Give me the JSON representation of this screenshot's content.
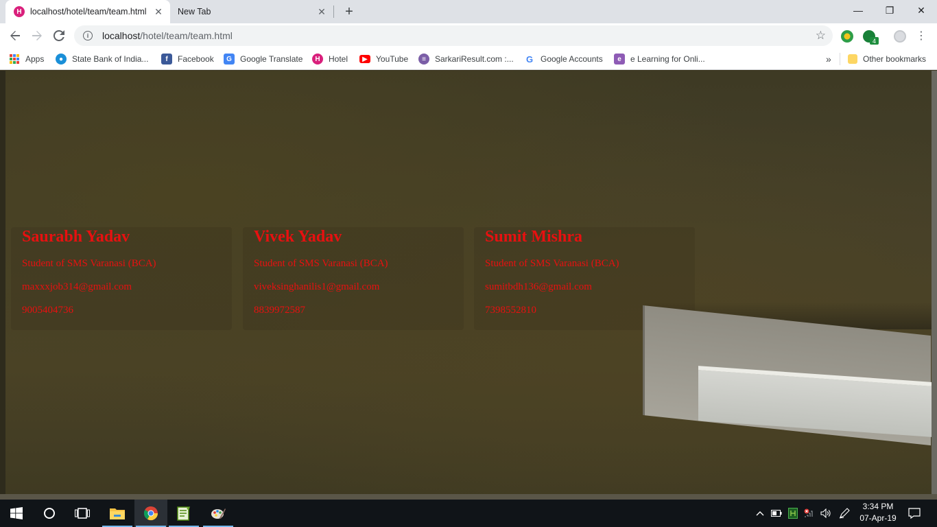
{
  "browser": {
    "tabs": [
      {
        "title": "localhost/hotel/team/team.html",
        "close": "✕"
      },
      {
        "title": "New Tab",
        "close": "✕"
      }
    ],
    "new_tab": "+",
    "window_controls": {
      "minimize": "—",
      "restore": "❐",
      "close": "✕"
    },
    "address": {
      "host": "localhost",
      "path": "/hotel/team/team.html"
    },
    "extension_badge": "4",
    "bookmarks": [
      {
        "label": "Apps",
        "icon": "apps-grid-icon"
      },
      {
        "label": "State Bank of India...",
        "icon": "sbi-icon"
      },
      {
        "label": "Facebook",
        "icon": "facebook-icon"
      },
      {
        "label": "Google Translate",
        "icon": "google-translate-icon"
      },
      {
        "label": "Hotel",
        "icon": "hotel-icon"
      },
      {
        "label": "YouTube",
        "icon": "youtube-icon"
      },
      {
        "label": "SarkariResult.com :...",
        "icon": "sarkari-icon"
      },
      {
        "label": "Google Accounts",
        "icon": "google-icon"
      },
      {
        "label": "e Learning for Onli...",
        "icon": "elearning-icon"
      }
    ],
    "overflow": "»",
    "other_bookmarks": "Other bookmarks"
  },
  "team": [
    {
      "name": "Saurabh Yadav",
      "role": "Student of SMS Varanasi (BCA)",
      "email": "maxxxjob314@gmail.com",
      "phone": "9005404736"
    },
    {
      "name": "Vivek Yadav",
      "role": "Student of SMS Varanasi (BCA)",
      "email": "viveksinghanilis1@gmail.com",
      "phone": "8839972587"
    },
    {
      "name": "Sumit Mishra",
      "role": "Student of SMS Varanasi (BCA)",
      "email": "sumitbdh136@gmail.com",
      "phone": "7398552810"
    }
  ],
  "taskbar": {
    "clock": {
      "time": "3:34 PM",
      "date": "07-Apr-19"
    }
  },
  "colors": {
    "text_accent": "#e81010",
    "tab_strip": "#dee1e6",
    "taskbar": "#101418"
  }
}
